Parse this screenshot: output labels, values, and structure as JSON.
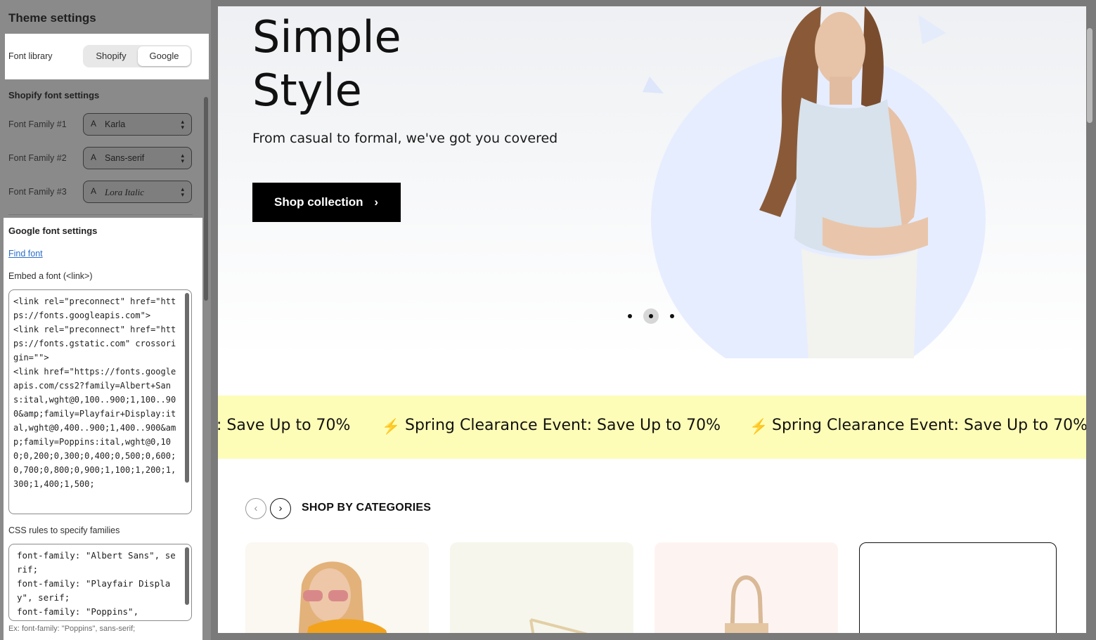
{
  "sidebar": {
    "title": "Theme settings",
    "font_library": {
      "label": "Font library",
      "options": [
        "Shopify",
        "Google"
      ],
      "selected": "Google"
    },
    "shopify_section": {
      "heading": "Shopify font settings",
      "families": [
        {
          "label": "Font Family #1",
          "value": "Karla"
        },
        {
          "label": "Font Family #2",
          "value": "Sans-serif"
        },
        {
          "label": "Font Family #3",
          "value": "Lora Italic"
        }
      ]
    },
    "google_section": {
      "heading": "Google font settings",
      "find_font": "Find font",
      "embed_label": "Embed a font (<link>)",
      "embed_code": "<link rel=\"preconnect\" href=\"https://fonts.googleapis.com\">\n<link rel=\"preconnect\" href=\"https://fonts.gstatic.com\" crossorigin=\"\">\n<link href=\"https://fonts.googleapis.com/css2?family=Albert+Sans:ital,wght@0,100..900;1,100..900&amp;family=Playfair+Display:ital,wght@0,400..900;1,400..900&amp;family=Poppins:ital,wght@0,100;0,200;0,300;0,400;0,500;0,600;0,700;0,800;0,900;1,100;1,200;1,300;1,400;1,500;",
      "css_label": "CSS rules to specify families",
      "css_code": "font-family: \"Albert Sans\", serif;\nfont-family: \"Playfair Display\", serif;\nfont-family: \"Poppins\",",
      "hint": "Ex: font-family: \"Poppins\", sans-serif;"
    }
  },
  "preview": {
    "hero": {
      "title_line1": "Simple",
      "title_line2": "Style",
      "subtitle": "From casual to formal, we've got you covered",
      "cta": "Shop collection",
      "cta_arrow": "›",
      "slide_count": 3,
      "active_slide": 2,
      "accent_circle": "#e6edff"
    },
    "marquee": {
      "fragment": ": Save Up to 70%",
      "text": "Spring Clearance Event: Save Up to 70%",
      "background": "#fdfdb7"
    },
    "categories": {
      "title": "SHOP BY CATEGORIES",
      "prev": "‹",
      "next": "›"
    }
  }
}
